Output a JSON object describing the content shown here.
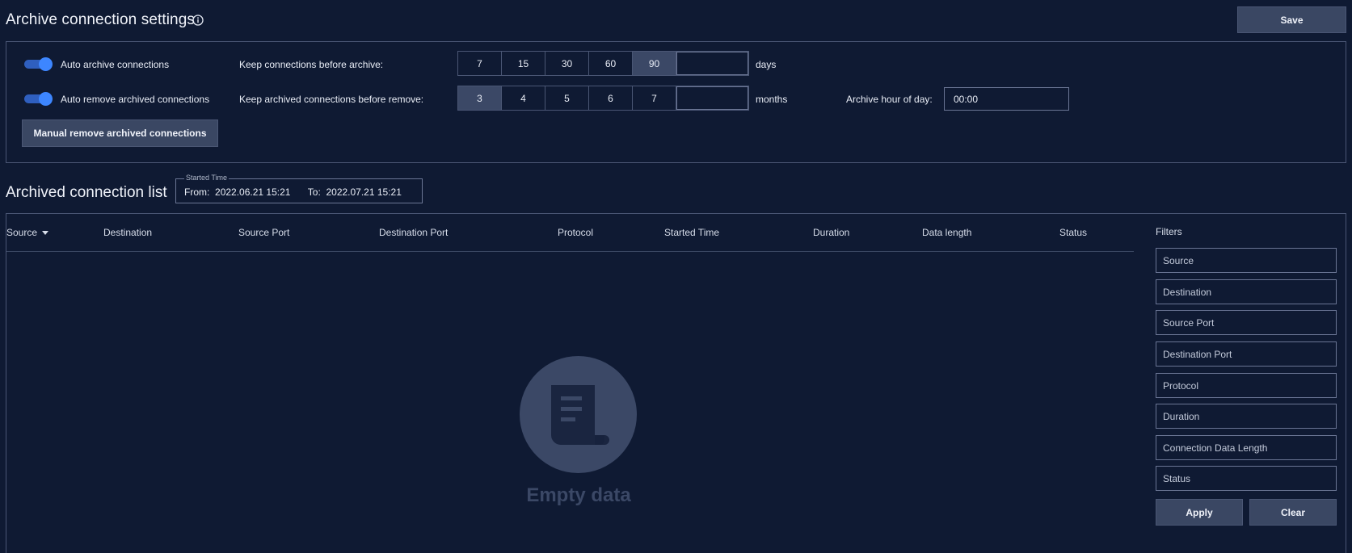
{
  "header": {
    "title": "Archive connection settings",
    "save_label": "Save"
  },
  "settings": {
    "auto_archive": {
      "label": "Auto archive connections",
      "enabled": true
    },
    "auto_remove": {
      "label": "Auto remove archived connections",
      "enabled": true
    },
    "keep_before_archive": {
      "label": "Keep connections before archive:",
      "options": [
        "7",
        "15",
        "30",
        "60",
        "90"
      ],
      "selected": "90",
      "custom_value": "",
      "unit": "days"
    },
    "keep_before_remove": {
      "label": "Keep archived connections before remove:",
      "options": [
        "3",
        "4",
        "5",
        "6",
        "7"
      ],
      "selected": "3",
      "custom_value": "",
      "unit": "months"
    },
    "archive_hour": {
      "label": "Archive hour of day:",
      "value": "00:00"
    },
    "manual_remove_label": "Manual remove archived connections"
  },
  "list": {
    "title": "Archived connection list",
    "started_time": {
      "legend": "Started Time",
      "from_label": "From:",
      "from_value": "2022.06.21 15:21",
      "to_label": "To:",
      "to_value": "2022.07.21 15:21"
    },
    "columns": [
      "Source",
      "Destination",
      "Source Port",
      "Destination Port",
      "Protocol",
      "Started Time",
      "Duration",
      "Data length",
      "Status"
    ],
    "sorted_by": "Source",
    "rows": [],
    "empty_text": "Empty data"
  },
  "filters": {
    "title": "Filters",
    "fields": [
      "Source",
      "Destination",
      "Source Port",
      "Destination Port",
      "Protocol",
      "Duration",
      "Connection Data Length",
      "Status"
    ],
    "apply_label": "Apply",
    "clear_label": "Clear"
  },
  "colors": {
    "background": "#0f1a33",
    "toggle_on": "#3d86ff",
    "selected_segment": "#3b4866",
    "border": "#4a5674"
  }
}
